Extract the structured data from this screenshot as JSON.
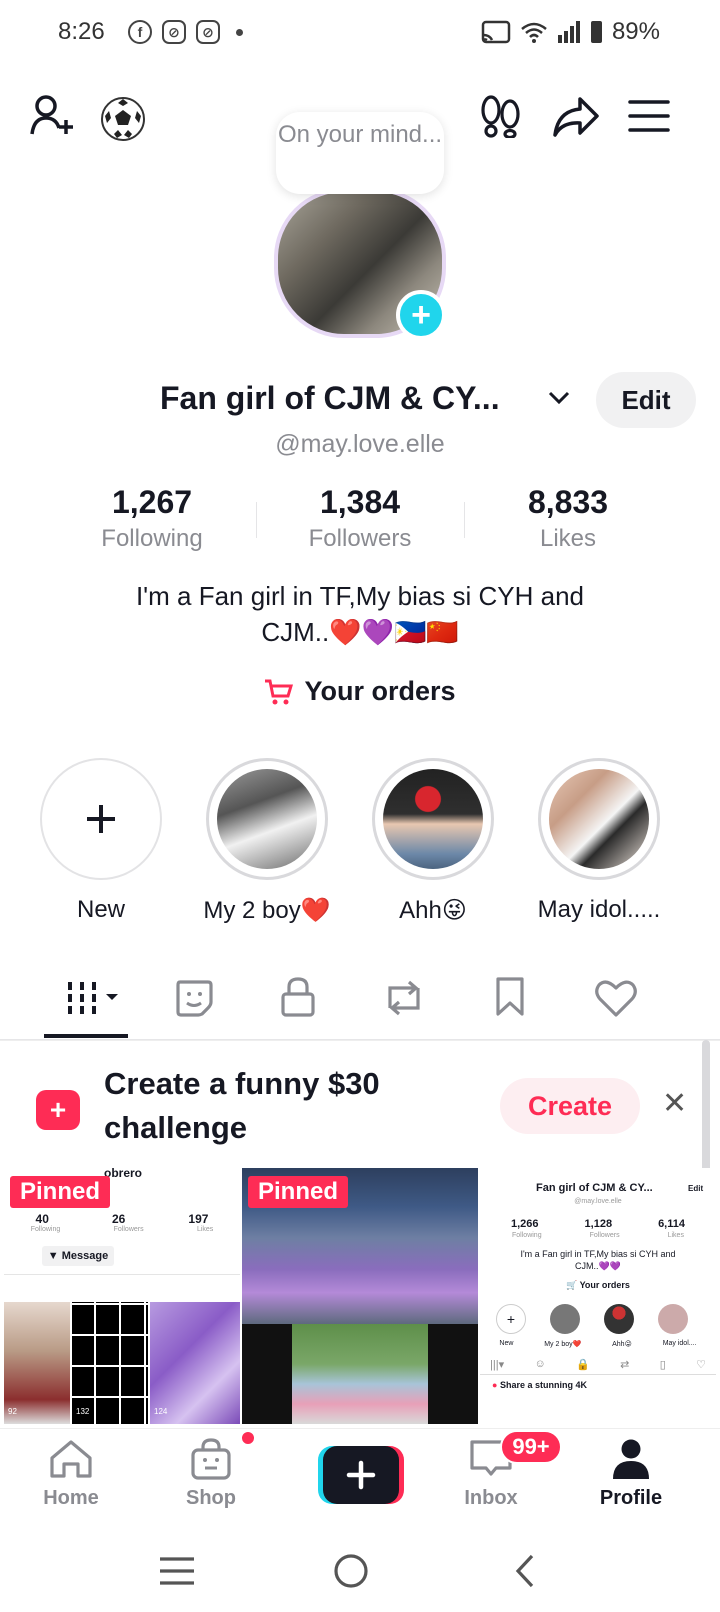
{
  "status_bar": {
    "time": "8:26",
    "battery": "89%"
  },
  "profile": {
    "thought_bubble": "On your mind...",
    "display_name": "Fan girl of CJM & CY...",
    "edit_label": "Edit",
    "handle": "@may.love.elle",
    "stats": [
      {
        "value": "1,267",
        "label": "Following"
      },
      {
        "value": "1,384",
        "label": "Followers"
      },
      {
        "value": "8,833",
        "label": "Likes"
      }
    ],
    "bio_line1": "I'm a Fan girl in TF,My bias si CYH and",
    "bio_line2": "CJM..❤️💜🇵🇭🇨🇳",
    "orders_label": "Your orders"
  },
  "highlights": [
    {
      "label": "New"
    },
    {
      "label": "My 2 boy❤️"
    },
    {
      "label": "Ahh😜"
    },
    {
      "label": "May idol....."
    }
  ],
  "banner": {
    "line1": "Create a funny $30",
    "line2": "challenge",
    "button": "Create"
  },
  "grid": {
    "pinned_label": "Pinned",
    "cell1": {
      "name_fragment": "obrero",
      "stats": [
        "40",
        "26",
        "197"
      ],
      "stat_labels": [
        "Following",
        "Followers",
        "Likes"
      ],
      "message": "Message",
      "views": [
        "92",
        "132",
        "124"
      ]
    },
    "cell3": {
      "name": "Fan girl of CJM & CY...",
      "edit": "Edit",
      "handle": "@may.love.elle",
      "stats": [
        "1,266",
        "1,128",
        "6,114"
      ],
      "stat_labels": [
        "Following",
        "Followers",
        "Likes"
      ],
      "bio": "I'm a Fan girl in TF,My bias si CYH and CJM..💜💜",
      "orders": "Your orders",
      "hl_labels": [
        "New",
        "My 2 boy❤️",
        "Ahh😜",
        "May idol...."
      ],
      "banner": "Share a stunning 4K"
    }
  },
  "bottom_nav": {
    "items": [
      {
        "label": "Home"
      },
      {
        "label": "Shop"
      },
      {
        "label": ""
      },
      {
        "label": "Inbox"
      },
      {
        "label": "Profile"
      }
    ],
    "inbox_badge": "99+"
  },
  "colors": {
    "accent": "#fe2c55",
    "cyan": "#20d5ec",
    "text": "#161823",
    "muted": "#8a8b91"
  }
}
